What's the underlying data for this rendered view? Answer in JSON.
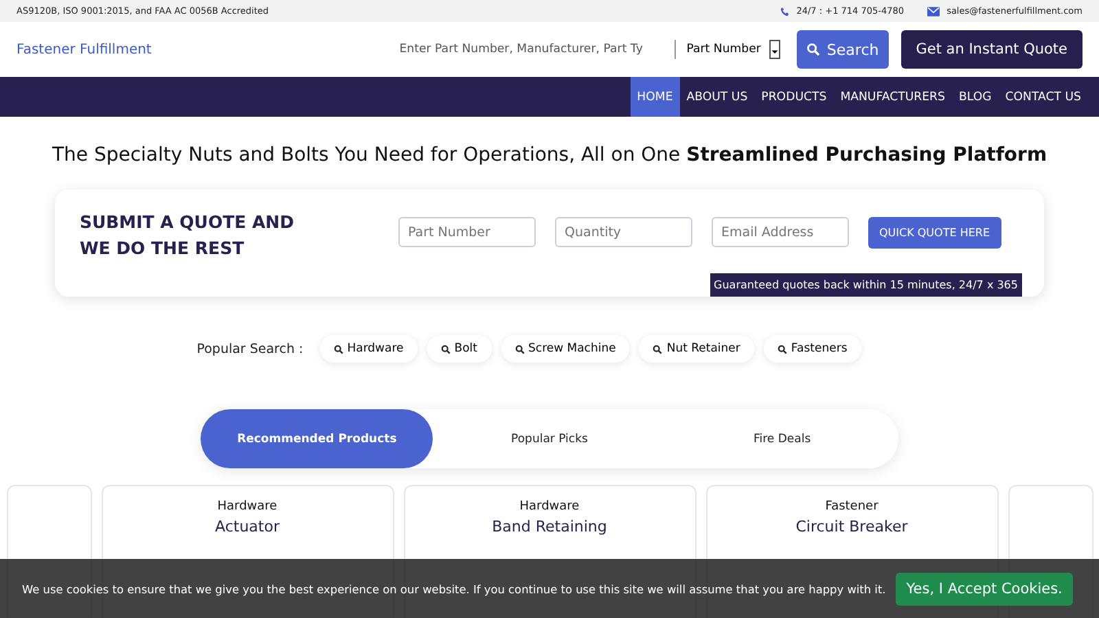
{
  "top_bar": {
    "accreditation": "AS9120B, ISO 9001:2015, and FAA AC 0056B Accredited",
    "phone": "24/7 : +1 714 705-4780",
    "email": "sales@fastenerfulfillment.com"
  },
  "header": {
    "logo": "Fastener Fulfillment",
    "search": {
      "placeholder": "Enter Part Number, Manufacturer, Part Ty",
      "type_select": "Part Number",
      "button": "Search"
    },
    "quote_button": "Get an Instant Quote"
  },
  "nav": [
    {
      "label": "HOME",
      "selected": true
    },
    {
      "label": "ABOUT US",
      "selected": false
    },
    {
      "label": "PRODUCTS",
      "selected": false
    },
    {
      "label": "MANUFACTURERS",
      "selected": false
    },
    {
      "label": "BLOG",
      "selected": false
    },
    {
      "label": "CONTACT US",
      "selected": false
    }
  ],
  "headline": "The Specialty Nuts and Bolts You Need for Operations, All on One **Streamlined Purchasing Platform**",
  "quote_form": {
    "title": "SUBMIT A QUOTE AND WE DO THE REST",
    "fields": [
      {
        "placeholder": "Part Number"
      },
      {
        "placeholder": "Quantity"
      },
      {
        "placeholder": "Email Address"
      }
    ],
    "button": "QUICK QUOTE HERE",
    "note": "Guaranteed quotes back within 15 minutes, 24/7 x 365"
  },
  "popular_search": {
    "label": "Popular Search :",
    "items": [
      "Hardware",
      "Bolt",
      "Screw Machine",
      "Nut Retainer",
      "Fasteners"
    ]
  },
  "product_tabs": [
    {
      "label": "Recommended Products",
      "selected": true
    },
    {
      "label": "Popular Picks",
      "selected": false
    },
    {
      "label": "Fire Deals",
      "selected": false
    }
  ],
  "products": [
    {
      "category": "Hardware",
      "title": "Actuator"
    },
    {
      "category": "Hardware",
      "title": "Band Retaining"
    },
    {
      "category": "Fastener",
      "title": "Circuit Breaker"
    }
  ],
  "cookie_bar": {
    "message": "We use cookies to ensure that we give you the best experience on our website. If you continue to use this site we will assume that you are happy with it.",
    "button": "Yes, I Accept Cookies."
  }
}
